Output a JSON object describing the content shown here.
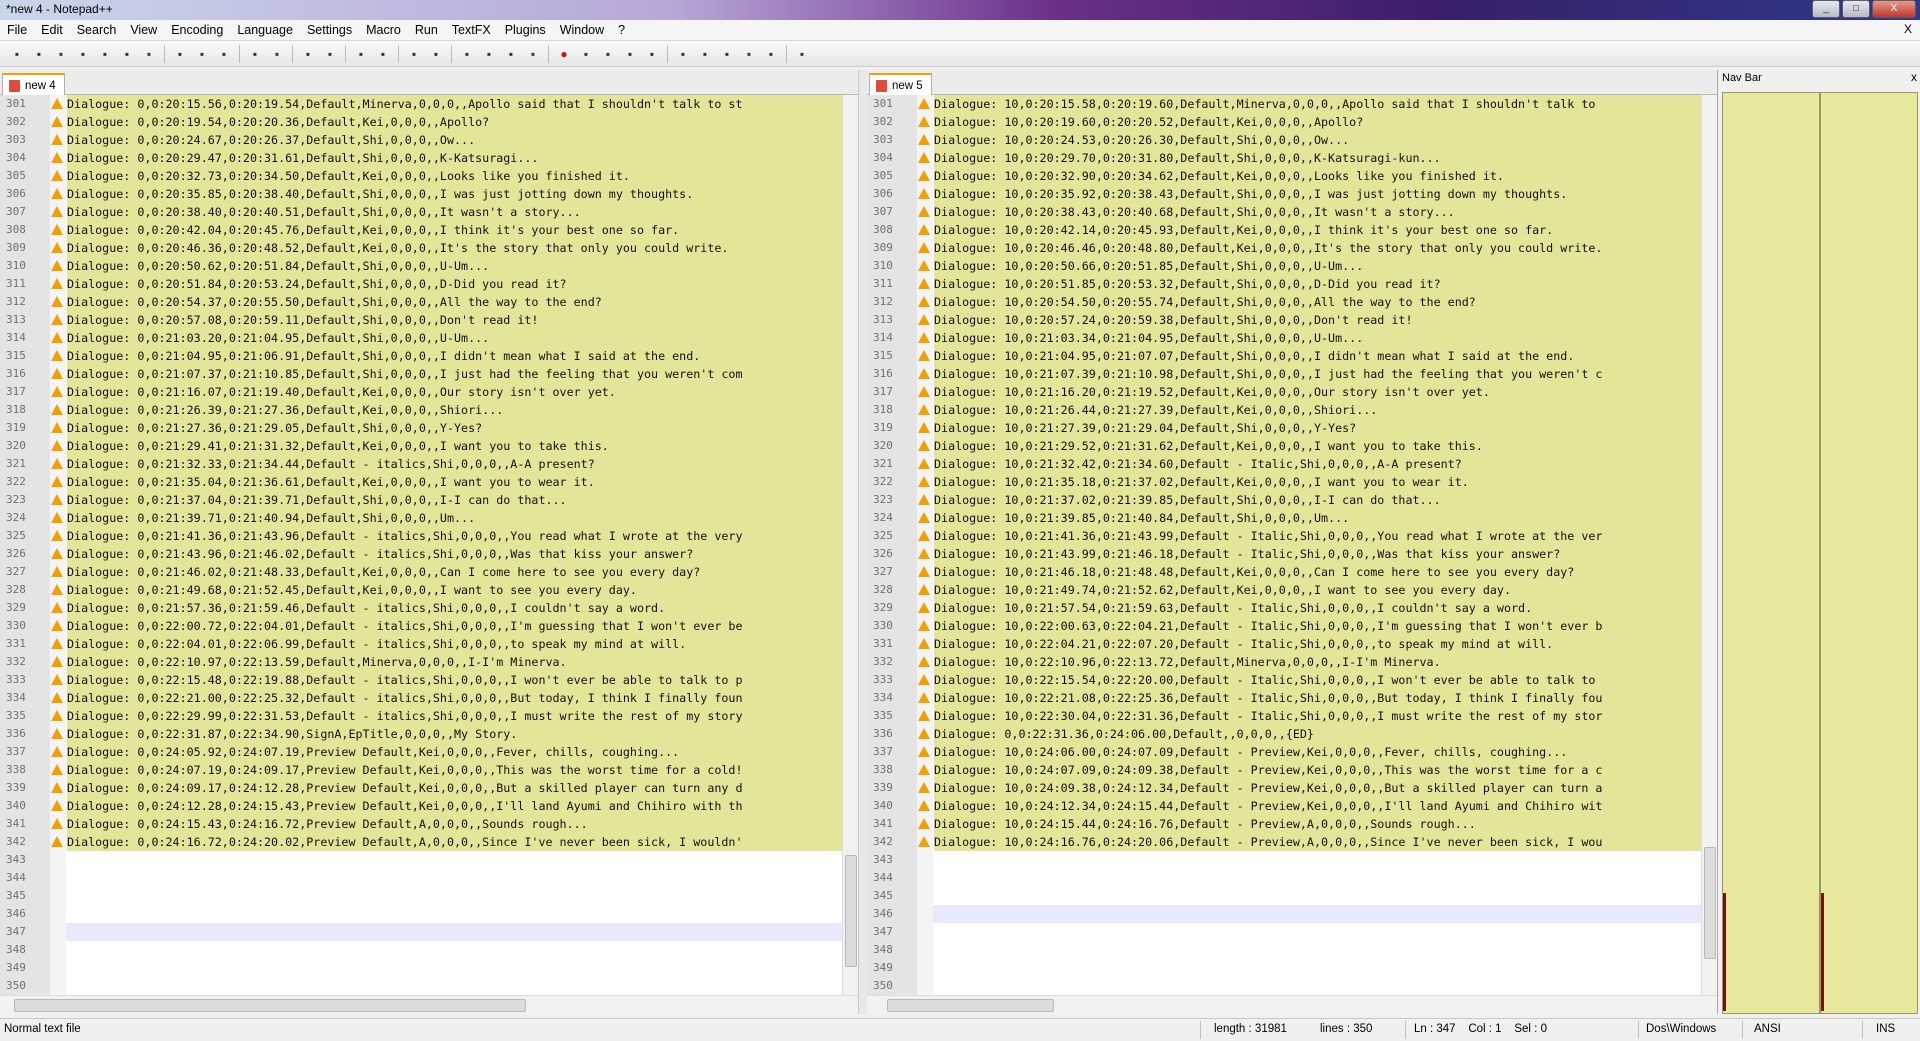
{
  "window": {
    "title": "*new 4 - Notepad++",
    "minimize": "_",
    "maximize": "□",
    "close": "X"
  },
  "menu": [
    "File",
    "Edit",
    "Search",
    "View",
    "Encoding",
    "Language",
    "Settings",
    "Macro",
    "Run",
    "TextFX",
    "Plugins",
    "Window",
    "?"
  ],
  "menu_close": "X",
  "toolbar_icons": [
    "new-file-icon",
    "open-file-icon",
    "save-icon",
    "save-all-icon",
    "close-icon",
    "close-all-icon",
    "print-icon",
    "cut-icon",
    "copy-icon",
    "paste-icon",
    "undo-icon",
    "redo-icon",
    "find-icon",
    "replace-icon",
    "zoom-in-icon",
    "zoom-out-icon",
    "sync-vertical-icon",
    "sync-horizontal-icon",
    "word-wrap-icon",
    "show-all-chars-icon",
    "indent-guide-icon",
    "doc-map-icon",
    "record-macro-icon",
    "stop-macro-icon",
    "play-macro-icon",
    "run-macro-multiple-icon",
    "save-macro-icon",
    "compare-icon",
    "prev-diff-icon",
    "next-diff-icon",
    "first-diff-icon",
    "settings-icon",
    "spell-check-icon"
  ],
  "left": {
    "tab": "new 4",
    "lines": [
      {
        "n": "301",
        "t": "Dialogue: 0,0:20:15.56,0:20:19.54,Default,Minerva,0,0,0,,Apollo said that I shouldn't talk to st"
      },
      {
        "n": "302",
        "t": "Dialogue: 0,0:20:19.54,0:20:20.36,Default,Kei,0,0,0,,Apollo?"
      },
      {
        "n": "303",
        "t": "Dialogue: 0,0:20:24.67,0:20:26.37,Default,Shi,0,0,0,,Ow..."
      },
      {
        "n": "304",
        "t": "Dialogue: 0,0:20:29.47,0:20:31.61,Default,Shi,0,0,0,,K-Katsuragi..."
      },
      {
        "n": "305",
        "t": "Dialogue: 0,0:20:32.73,0:20:34.50,Default,Kei,0,0,0,,Looks like you finished it."
      },
      {
        "n": "306",
        "t": "Dialogue: 0,0:20:35.85,0:20:38.40,Default,Shi,0,0,0,,I was just jotting down my thoughts."
      },
      {
        "n": "307",
        "t": "Dialogue: 0,0:20:38.40,0:20:40.51,Default,Shi,0,0,0,,It wasn't a story..."
      },
      {
        "n": "308",
        "t": "Dialogue: 0,0:20:42.04,0:20:45.76,Default,Kei,0,0,0,,I think it's your best one so far."
      },
      {
        "n": "309",
        "t": "Dialogue: 0,0:20:46.36,0:20:48.52,Default,Kei,0,0,0,,It's the story that only you could write."
      },
      {
        "n": "310",
        "t": "Dialogue: 0,0:20:50.62,0:20:51.84,Default,Shi,0,0,0,,U-Um..."
      },
      {
        "n": "311",
        "t": "Dialogue: 0,0:20:51.84,0:20:53.24,Default,Shi,0,0,0,,D-Did you read it?"
      },
      {
        "n": "312",
        "t": "Dialogue: 0,0:20:54.37,0:20:55.50,Default,Shi,0,0,0,,All the way to the end?"
      },
      {
        "n": "313",
        "t": "Dialogue: 0,0:20:57.08,0:20:59.11,Default,Shi,0,0,0,,Don't read it!"
      },
      {
        "n": "314",
        "t": "Dialogue: 0,0:21:03.20,0:21:04.95,Default,Shi,0,0,0,,U-Um..."
      },
      {
        "n": "315",
        "t": "Dialogue: 0,0:21:04.95,0:21:06.91,Default,Shi,0,0,0,,I didn't mean what I said at the end."
      },
      {
        "n": "316",
        "t": "Dialogue: 0,0:21:07.37,0:21:10.85,Default,Shi,0,0,0,,I just had the feeling that you weren't com"
      },
      {
        "n": "317",
        "t": "Dialogue: 0,0:21:16.07,0:21:19.40,Default,Kei,0,0,0,,Our story isn't over yet."
      },
      {
        "n": "318",
        "t": "Dialogue: 0,0:21:26.39,0:21:27.36,Default,Kei,0,0,0,,Shiori..."
      },
      {
        "n": "319",
        "t": "Dialogue: 0,0:21:27.36,0:21:29.05,Default,Shi,0,0,0,,Y-Yes?"
      },
      {
        "n": "320",
        "t": "Dialogue: 0,0:21:29.41,0:21:31.32,Default,Kei,0,0,0,,I want you to take this."
      },
      {
        "n": "321",
        "t": "Dialogue: 0,0:21:32.33,0:21:34.44,Default - italics,Shi,0,0,0,,A-A present?"
      },
      {
        "n": "322",
        "t": "Dialogue: 0,0:21:35.04,0:21:36.61,Default,Kei,0,0,0,,I want you to wear it."
      },
      {
        "n": "323",
        "t": "Dialogue: 0,0:21:37.04,0:21:39.71,Default,Shi,0,0,0,,I-I can do that..."
      },
      {
        "n": "324",
        "t": "Dialogue: 0,0:21:39.71,0:21:40.94,Default,Shi,0,0,0,,Um..."
      },
      {
        "n": "325",
        "t": "Dialogue: 0,0:21:41.36,0:21:43.96,Default - italics,Shi,0,0,0,,You read what I wrote at the very"
      },
      {
        "n": "326",
        "t": "Dialogue: 0,0:21:43.96,0:21:46.02,Default - italics,Shi,0,0,0,,Was that kiss your answer?"
      },
      {
        "n": "327",
        "t": "Dialogue: 0,0:21:46.02,0:21:48.33,Default,Kei,0,0,0,,Can I come here to see you every day?"
      },
      {
        "n": "328",
        "t": "Dialogue: 0,0:21:49.68,0:21:52.45,Default,Kei,0,0,0,,I want to see you every day."
      },
      {
        "n": "329",
        "t": "Dialogue: 0,0:21:57.36,0:21:59.46,Default - italics,Shi,0,0,0,,I couldn't say a word."
      },
      {
        "n": "330",
        "t": "Dialogue: 0,0:22:00.72,0:22:04.01,Default - italics,Shi,0,0,0,,I'm guessing that I won't ever be"
      },
      {
        "n": "331",
        "t": "Dialogue: 0,0:22:04.01,0:22:06.99,Default - italics,Shi,0,0,0,,to speak my mind at will."
      },
      {
        "n": "332",
        "t": "Dialogue: 0,0:22:10.97,0:22:13.59,Default,Minerva,0,0,0,,I-I'm Minerva."
      },
      {
        "n": "333",
        "t": "Dialogue: 0,0:22:15.48,0:22:19.88,Default - italics,Shi,0,0,0,,I won't ever be able to talk to p"
      },
      {
        "n": "334",
        "t": "Dialogue: 0,0:22:21.00,0:22:25.32,Default - italics,Shi,0,0,0,,But today, I think I finally foun"
      },
      {
        "n": "335",
        "t": "Dialogue: 0,0:22:29.99,0:22:31.53,Default - italics,Shi,0,0,0,,I must write the rest of my story"
      },
      {
        "n": "336",
        "t": "Dialogue: 0,0:22:31.87,0:22:34.90,SignA,EpTitle,0,0,0,,My Story."
      },
      {
        "n": "337",
        "t": "Dialogue: 0,0:24:05.92,0:24:07.19,Preview Default,Kei,0,0,0,,Fever, chills, coughing..."
      },
      {
        "n": "338",
        "t": "Dialogue: 0,0:24:07.19,0:24:09.17,Preview Default,Kei,0,0,0,,This was the worst time for a cold!"
      },
      {
        "n": "339",
        "t": "Dialogue: 0,0:24:09.17,0:24:12.28,Preview Default,Kei,0,0,0,,But a skilled player can turn any d"
      },
      {
        "n": "340",
        "t": "Dialogue: 0,0:24:12.28,0:24:15.43,Preview Default,Kei,0,0,0,,I'll land Ayumi and Chihiro with th"
      },
      {
        "n": "341",
        "t": "Dialogue: 0,0:24:15.43,0:24:16.72,Preview Default,A,0,0,0,,Sounds rough..."
      },
      {
        "n": "342",
        "t": "Dialogue: 0,0:24:16.72,0:24:20.02,Preview Default,A,0,0,0,,Since I've never been sick, I wouldn'"
      },
      {
        "n": "343",
        "t": ""
      },
      {
        "n": "344",
        "t": ""
      },
      {
        "n": "345",
        "t": ""
      },
      {
        "n": "346",
        "t": ""
      },
      {
        "n": "347",
        "t": ""
      },
      {
        "n": "348",
        "t": ""
      },
      {
        "n": "349",
        "t": ""
      },
      {
        "n": "350",
        "t": ""
      }
    ]
  },
  "right": {
    "tab": "new 5",
    "lines": [
      {
        "n": "301",
        "t": "Dialogue: 10,0:20:15.58,0:20:19.60,Default,Minerva,0,0,0,,Apollo said that I shouldn't talk to"
      },
      {
        "n": "302",
        "t": "Dialogue: 10,0:20:19.60,0:20:20.52,Default,Kei,0,0,0,,Apollo?"
      },
      {
        "n": "303",
        "t": "Dialogue: 10,0:20:24.53,0:20:26.30,Default,Shi,0,0,0,,Ow..."
      },
      {
        "n": "304",
        "t": "Dialogue: 10,0:20:29.70,0:20:31.80,Default,Shi,0,0,0,,K-Katsuragi-kun..."
      },
      {
        "n": "305",
        "t": "Dialogue: 10,0:20:32.90,0:20:34.62,Default,Kei,0,0,0,,Looks like you finished it."
      },
      {
        "n": "306",
        "t": "Dialogue: 10,0:20:35.92,0:20:38.43,Default,Shi,0,0,0,,I was just jotting down my thoughts."
      },
      {
        "n": "307",
        "t": "Dialogue: 10,0:20:38.43,0:20:40.68,Default,Shi,0,0,0,,It wasn't a story..."
      },
      {
        "n": "308",
        "t": "Dialogue: 10,0:20:42.14,0:20:45.93,Default,Kei,0,0,0,,I think it's your best one so far."
      },
      {
        "n": "309",
        "t": "Dialogue: 10,0:20:46.46,0:20:48.80,Default,Kei,0,0,0,,It's the story that only you could write."
      },
      {
        "n": "310",
        "t": "Dialogue: 10,0:20:50.66,0:20:51.85,Default,Shi,0,0,0,,U-Um..."
      },
      {
        "n": "311",
        "t": "Dialogue: 10,0:20:51.85,0:20:53.32,Default,Shi,0,0,0,,D-Did you read it?"
      },
      {
        "n": "312",
        "t": "Dialogue: 10,0:20:54.50,0:20:55.74,Default,Shi,0,0,0,,All the way to the end?"
      },
      {
        "n": "313",
        "t": "Dialogue: 10,0:20:57.24,0:20:59.38,Default,Shi,0,0,0,,Don't read it!"
      },
      {
        "n": "314",
        "t": "Dialogue: 10,0:21:03.34,0:21:04.95,Default,Shi,0,0,0,,U-Um..."
      },
      {
        "n": "315",
        "t": "Dialogue: 10,0:21:04.95,0:21:07.07,Default,Shi,0,0,0,,I didn't mean what I said at the end."
      },
      {
        "n": "316",
        "t": "Dialogue: 10,0:21:07.39,0:21:10.98,Default,Shi,0,0,0,,I just had the feeling that you weren't c"
      },
      {
        "n": "317",
        "t": "Dialogue: 10,0:21:16.20,0:21:19.52,Default,Kei,0,0,0,,Our story isn't over yet."
      },
      {
        "n": "318",
        "t": "Dialogue: 10,0:21:26.44,0:21:27.39,Default,Kei,0,0,0,,Shiori..."
      },
      {
        "n": "319",
        "t": "Dialogue: 10,0:21:27.39,0:21:29.04,Default,Shi,0,0,0,,Y-Yes?"
      },
      {
        "n": "320",
        "t": "Dialogue: 10,0:21:29.52,0:21:31.62,Default,Kei,0,0,0,,I want you to take this."
      },
      {
        "n": "321",
        "t": "Dialogue: 10,0:21:32.42,0:21:34.60,Default - Italic,Shi,0,0,0,,A-A present?"
      },
      {
        "n": "322",
        "t": "Dialogue: 10,0:21:35.18,0:21:37.02,Default,Kei,0,0,0,,I want you to wear it."
      },
      {
        "n": "323",
        "t": "Dialogue: 10,0:21:37.02,0:21:39.85,Default,Shi,0,0,0,,I-I can do that..."
      },
      {
        "n": "324",
        "t": "Dialogue: 10,0:21:39.85,0:21:40.84,Default,Shi,0,0,0,,Um..."
      },
      {
        "n": "325",
        "t": "Dialogue: 10,0:21:41.36,0:21:43.99,Default - Italic,Shi,0,0,0,,You read what I wrote at the ver"
      },
      {
        "n": "326",
        "t": "Dialogue: 10,0:21:43.99,0:21:46.18,Default - Italic,Shi,0,0,0,,Was that kiss your answer?"
      },
      {
        "n": "327",
        "t": "Dialogue: 10,0:21:46.18,0:21:48.48,Default,Kei,0,0,0,,Can I come here to see you every day?"
      },
      {
        "n": "328",
        "t": "Dialogue: 10,0:21:49.74,0:21:52.62,Default,Kei,0,0,0,,I want to see you every day."
      },
      {
        "n": "329",
        "t": "Dialogue: 10,0:21:57.54,0:21:59.63,Default - Italic,Shi,0,0,0,,I couldn't say a word."
      },
      {
        "n": "330",
        "t": "Dialogue: 10,0:22:00.63,0:22:04.21,Default - Italic,Shi,0,0,0,,I'm guessing that I won't ever b"
      },
      {
        "n": "331",
        "t": "Dialogue: 10,0:22:04.21,0:22:07.20,Default - Italic,Shi,0,0,0,,to speak my mind at will."
      },
      {
        "n": "332",
        "t": "Dialogue: 10,0:22:10.96,0:22:13.72,Default,Minerva,0,0,0,,I-I'm Minerva."
      },
      {
        "n": "333",
        "t": "Dialogue: 10,0:22:15.54,0:22:20.00,Default - Italic,Shi,0,0,0,,I won't ever be able to talk to"
      },
      {
        "n": "334",
        "t": "Dialogue: 10,0:22:21.08,0:22:25.36,Default - Italic,Shi,0,0,0,,But today, I think I finally fou"
      },
      {
        "n": "335",
        "t": "Dialogue: 10,0:22:30.04,0:22:31.36,Default - Italic,Shi,0,0,0,,I must write the rest of my stor"
      },
      {
        "n": "336",
        "t": "Dialogue: 0,0:22:31.36,0:24:06.00,Default,,0,0,0,,{ED}"
      },
      {
        "n": "337",
        "t": "Dialogue: 10,0:24:06.00,0:24:07.09,Default - Preview,Kei,0,0,0,,Fever, chills, coughing..."
      },
      {
        "n": "338",
        "t": "Dialogue: 10,0:24:07.09,0:24:09.38,Default - Preview,Kei,0,0,0,,This was the worst time for a c"
      },
      {
        "n": "339",
        "t": "Dialogue: 10,0:24:09.38,0:24:12.34,Default - Preview,Kei,0,0,0,,But a skilled player can turn a"
      },
      {
        "n": "340",
        "t": "Dialogue: 10,0:24:12.34,0:24:15.44,Default - Preview,Kei,0,0,0,,I'll land Ayumi and Chihiro wit"
      },
      {
        "n": "341",
        "t": "Dialogue: 10,0:24:15.44,0:24:16.76,Default - Preview,A,0,0,0,,Sounds rough..."
      },
      {
        "n": "342",
        "t": "Dialogue: 10,0:24:16.76,0:24:20.06,Default - Preview,A,0,0,0,,Since I've never been sick, I wou"
      },
      {
        "n": "343",
        "t": ""
      },
      {
        "n": "344",
        "t": ""
      },
      {
        "n": "345",
        "t": ""
      },
      {
        "n": "346",
        "t": ""
      },
      {
        "n": "347",
        "t": ""
      },
      {
        "n": "348",
        "t": ""
      },
      {
        "n": "349",
        "t": ""
      },
      {
        "n": "350",
        "t": ""
      }
    ]
  },
  "navbar": {
    "title": "Nav Bar",
    "close": "x"
  },
  "status": {
    "file_type": "Normal text file",
    "length": "length : 31981",
    "lines": "lines : 350",
    "position": "Ln : 347    Col : 1    Sel : 0",
    "eol": "Dos\\Windows",
    "encoding": "ANSI",
    "mode": "INS"
  },
  "colors": {
    "diff_line": "#e5e59a",
    "warning": "#f2a000",
    "caret_line": "#e8e8ff",
    "tab_accent": "#f0a000"
  }
}
